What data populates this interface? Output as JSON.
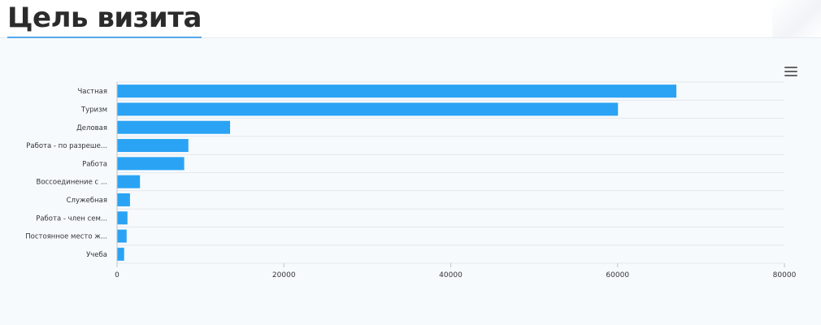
{
  "page": {
    "title": "Цель визита"
  },
  "toolbar": {
    "menu_icon": "hamburger-menu-icon"
  },
  "colors": {
    "bar": "#2aa3f4",
    "grid": "#e4e8ec",
    "axis": "#bfc4c9",
    "title_underline": "#53a9ec"
  },
  "chart_data": {
    "type": "bar",
    "orientation": "horizontal",
    "title": "",
    "xlabel": "",
    "ylabel": "",
    "categories": [
      "Частная",
      "Туризм",
      "Деловая",
      "Работа - по разреше...",
      "Работа",
      "Воссоединение с ...",
      "Служебная",
      "Работа - член сем...",
      "Постоянное место ж...",
      "Учеба"
    ],
    "values": [
      67000,
      60000,
      13500,
      8500,
      8000,
      2700,
      1500,
      1200,
      1100,
      800
    ],
    "xlim": [
      0,
      80000
    ],
    "xticks": [
      0,
      20000,
      40000,
      60000,
      80000
    ],
    "xtick_labels": [
      "0",
      "20000",
      "40000",
      "60000",
      "80000"
    ],
    "grid": true,
    "legend": "none"
  }
}
